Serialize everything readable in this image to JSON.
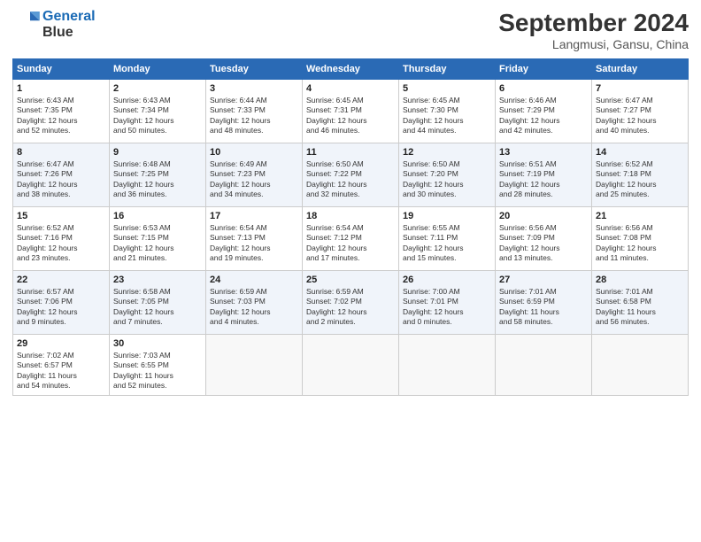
{
  "header": {
    "logo_line1": "General",
    "logo_line2": "Blue",
    "month": "September 2024",
    "location": "Langmusi, Gansu, China"
  },
  "weekdays": [
    "Sunday",
    "Monday",
    "Tuesday",
    "Wednesday",
    "Thursday",
    "Friday",
    "Saturday"
  ],
  "weeks": [
    [
      {
        "day": "1",
        "info": "Sunrise: 6:43 AM\nSunset: 7:35 PM\nDaylight: 12 hours\nand 52 minutes."
      },
      {
        "day": "2",
        "info": "Sunrise: 6:43 AM\nSunset: 7:34 PM\nDaylight: 12 hours\nand 50 minutes."
      },
      {
        "day": "3",
        "info": "Sunrise: 6:44 AM\nSunset: 7:33 PM\nDaylight: 12 hours\nand 48 minutes."
      },
      {
        "day": "4",
        "info": "Sunrise: 6:45 AM\nSunset: 7:31 PM\nDaylight: 12 hours\nand 46 minutes."
      },
      {
        "day": "5",
        "info": "Sunrise: 6:45 AM\nSunset: 7:30 PM\nDaylight: 12 hours\nand 44 minutes."
      },
      {
        "day": "6",
        "info": "Sunrise: 6:46 AM\nSunset: 7:29 PM\nDaylight: 12 hours\nand 42 minutes."
      },
      {
        "day": "7",
        "info": "Sunrise: 6:47 AM\nSunset: 7:27 PM\nDaylight: 12 hours\nand 40 minutes."
      }
    ],
    [
      {
        "day": "8",
        "info": "Sunrise: 6:47 AM\nSunset: 7:26 PM\nDaylight: 12 hours\nand 38 minutes."
      },
      {
        "day": "9",
        "info": "Sunrise: 6:48 AM\nSunset: 7:25 PM\nDaylight: 12 hours\nand 36 minutes."
      },
      {
        "day": "10",
        "info": "Sunrise: 6:49 AM\nSunset: 7:23 PM\nDaylight: 12 hours\nand 34 minutes."
      },
      {
        "day": "11",
        "info": "Sunrise: 6:50 AM\nSunset: 7:22 PM\nDaylight: 12 hours\nand 32 minutes."
      },
      {
        "day": "12",
        "info": "Sunrise: 6:50 AM\nSunset: 7:20 PM\nDaylight: 12 hours\nand 30 minutes."
      },
      {
        "day": "13",
        "info": "Sunrise: 6:51 AM\nSunset: 7:19 PM\nDaylight: 12 hours\nand 28 minutes."
      },
      {
        "day": "14",
        "info": "Sunrise: 6:52 AM\nSunset: 7:18 PM\nDaylight: 12 hours\nand 25 minutes."
      }
    ],
    [
      {
        "day": "15",
        "info": "Sunrise: 6:52 AM\nSunset: 7:16 PM\nDaylight: 12 hours\nand 23 minutes."
      },
      {
        "day": "16",
        "info": "Sunrise: 6:53 AM\nSunset: 7:15 PM\nDaylight: 12 hours\nand 21 minutes."
      },
      {
        "day": "17",
        "info": "Sunrise: 6:54 AM\nSunset: 7:13 PM\nDaylight: 12 hours\nand 19 minutes."
      },
      {
        "day": "18",
        "info": "Sunrise: 6:54 AM\nSunset: 7:12 PM\nDaylight: 12 hours\nand 17 minutes."
      },
      {
        "day": "19",
        "info": "Sunrise: 6:55 AM\nSunset: 7:11 PM\nDaylight: 12 hours\nand 15 minutes."
      },
      {
        "day": "20",
        "info": "Sunrise: 6:56 AM\nSunset: 7:09 PM\nDaylight: 12 hours\nand 13 minutes."
      },
      {
        "day": "21",
        "info": "Sunrise: 6:56 AM\nSunset: 7:08 PM\nDaylight: 12 hours\nand 11 minutes."
      }
    ],
    [
      {
        "day": "22",
        "info": "Sunrise: 6:57 AM\nSunset: 7:06 PM\nDaylight: 12 hours\nand 9 minutes."
      },
      {
        "day": "23",
        "info": "Sunrise: 6:58 AM\nSunset: 7:05 PM\nDaylight: 12 hours\nand 7 minutes."
      },
      {
        "day": "24",
        "info": "Sunrise: 6:59 AM\nSunset: 7:03 PM\nDaylight: 12 hours\nand 4 minutes."
      },
      {
        "day": "25",
        "info": "Sunrise: 6:59 AM\nSunset: 7:02 PM\nDaylight: 12 hours\nand 2 minutes."
      },
      {
        "day": "26",
        "info": "Sunrise: 7:00 AM\nSunset: 7:01 PM\nDaylight: 12 hours\nand 0 minutes."
      },
      {
        "day": "27",
        "info": "Sunrise: 7:01 AM\nSunset: 6:59 PM\nDaylight: 11 hours\nand 58 minutes."
      },
      {
        "day": "28",
        "info": "Sunrise: 7:01 AM\nSunset: 6:58 PM\nDaylight: 11 hours\nand 56 minutes."
      }
    ],
    [
      {
        "day": "29",
        "info": "Sunrise: 7:02 AM\nSunset: 6:57 PM\nDaylight: 11 hours\nand 54 minutes."
      },
      {
        "day": "30",
        "info": "Sunrise: 7:03 AM\nSunset: 6:55 PM\nDaylight: 11 hours\nand 52 minutes."
      },
      {
        "day": "",
        "info": ""
      },
      {
        "day": "",
        "info": ""
      },
      {
        "day": "",
        "info": ""
      },
      {
        "day": "",
        "info": ""
      },
      {
        "day": "",
        "info": ""
      }
    ]
  ]
}
